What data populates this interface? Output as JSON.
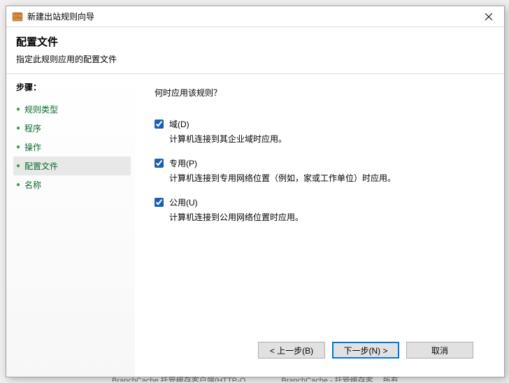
{
  "window": {
    "title": "新建出站规则向导"
  },
  "header": {
    "title": "配置文件",
    "subtitle": "指定此规则应用的配置文件"
  },
  "sidebar": {
    "heading": "步骤：",
    "items": [
      {
        "label": "规则类型",
        "current": false
      },
      {
        "label": "程序",
        "current": false
      },
      {
        "label": "操作",
        "current": false
      },
      {
        "label": "配置文件",
        "current": true
      },
      {
        "label": "名称",
        "current": false
      }
    ]
  },
  "content": {
    "question": "何时应用该规则？",
    "options": [
      {
        "key": "domain",
        "label": "域(D)",
        "desc": "计算机连接到其企业域时应用。",
        "checked": true
      },
      {
        "key": "private",
        "label": "专用(P)",
        "desc": "计算机连接到专用网络位置（例如，家或工作单位）时应用。",
        "checked": true
      },
      {
        "key": "public",
        "label": "公用(U)",
        "desc": "计算机连接到公用网络位置时应用。",
        "checked": true
      }
    ]
  },
  "footer": {
    "back": "< 上一步(B)",
    "next": "下一步(N) >",
    "cancel": "取消"
  },
  "taskbar": {
    "frag1": "BranchCache 托管缓存客户端(HTTP-O…",
    "frag2": "BranchCache - 托管缓存客…   所有"
  }
}
